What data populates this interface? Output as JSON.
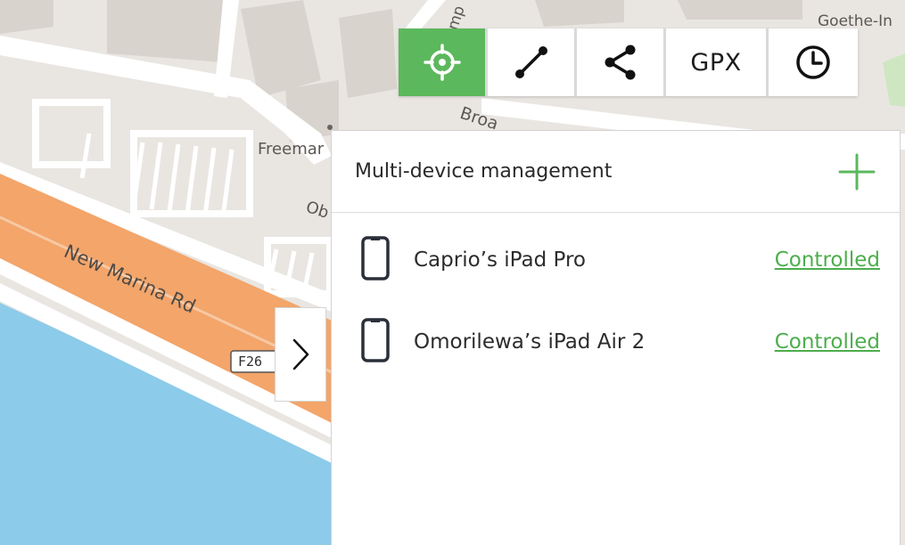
{
  "map": {
    "labels": {
      "goethe": "Goethe-In",
      "freeman": "Freemar",
      "broad": "Broa",
      "camp": "amp",
      "ob": "Ob",
      "new_marina": "New Marina Rd",
      "route": "F26"
    },
    "colors": {
      "land": "#e9e6e2",
      "water": "#8ccbea",
      "road_major": "#f3a56a",
      "road_minor": "#ffffff",
      "building": "#d9d3cd"
    }
  },
  "toolbar": {
    "locate_icon": "crosshair-icon",
    "route_icon": "route-icon",
    "share_icon": "share-icon",
    "gpx_label": "GPX",
    "history_icon": "clock-icon",
    "accent": "#5cb85c"
  },
  "panel": {
    "title": "Multi-device management",
    "add_icon": "plus-icon",
    "devices": [
      {
        "name": "Caprio’s iPad Pro",
        "status": "Controlled",
        "icon": "tablet-icon"
      },
      {
        "name": "Omorilewa’s iPad Air 2",
        "status": "Controlled",
        "icon": "tablet-icon"
      }
    ]
  },
  "collapse": {
    "icon": "chevron-right-icon"
  }
}
